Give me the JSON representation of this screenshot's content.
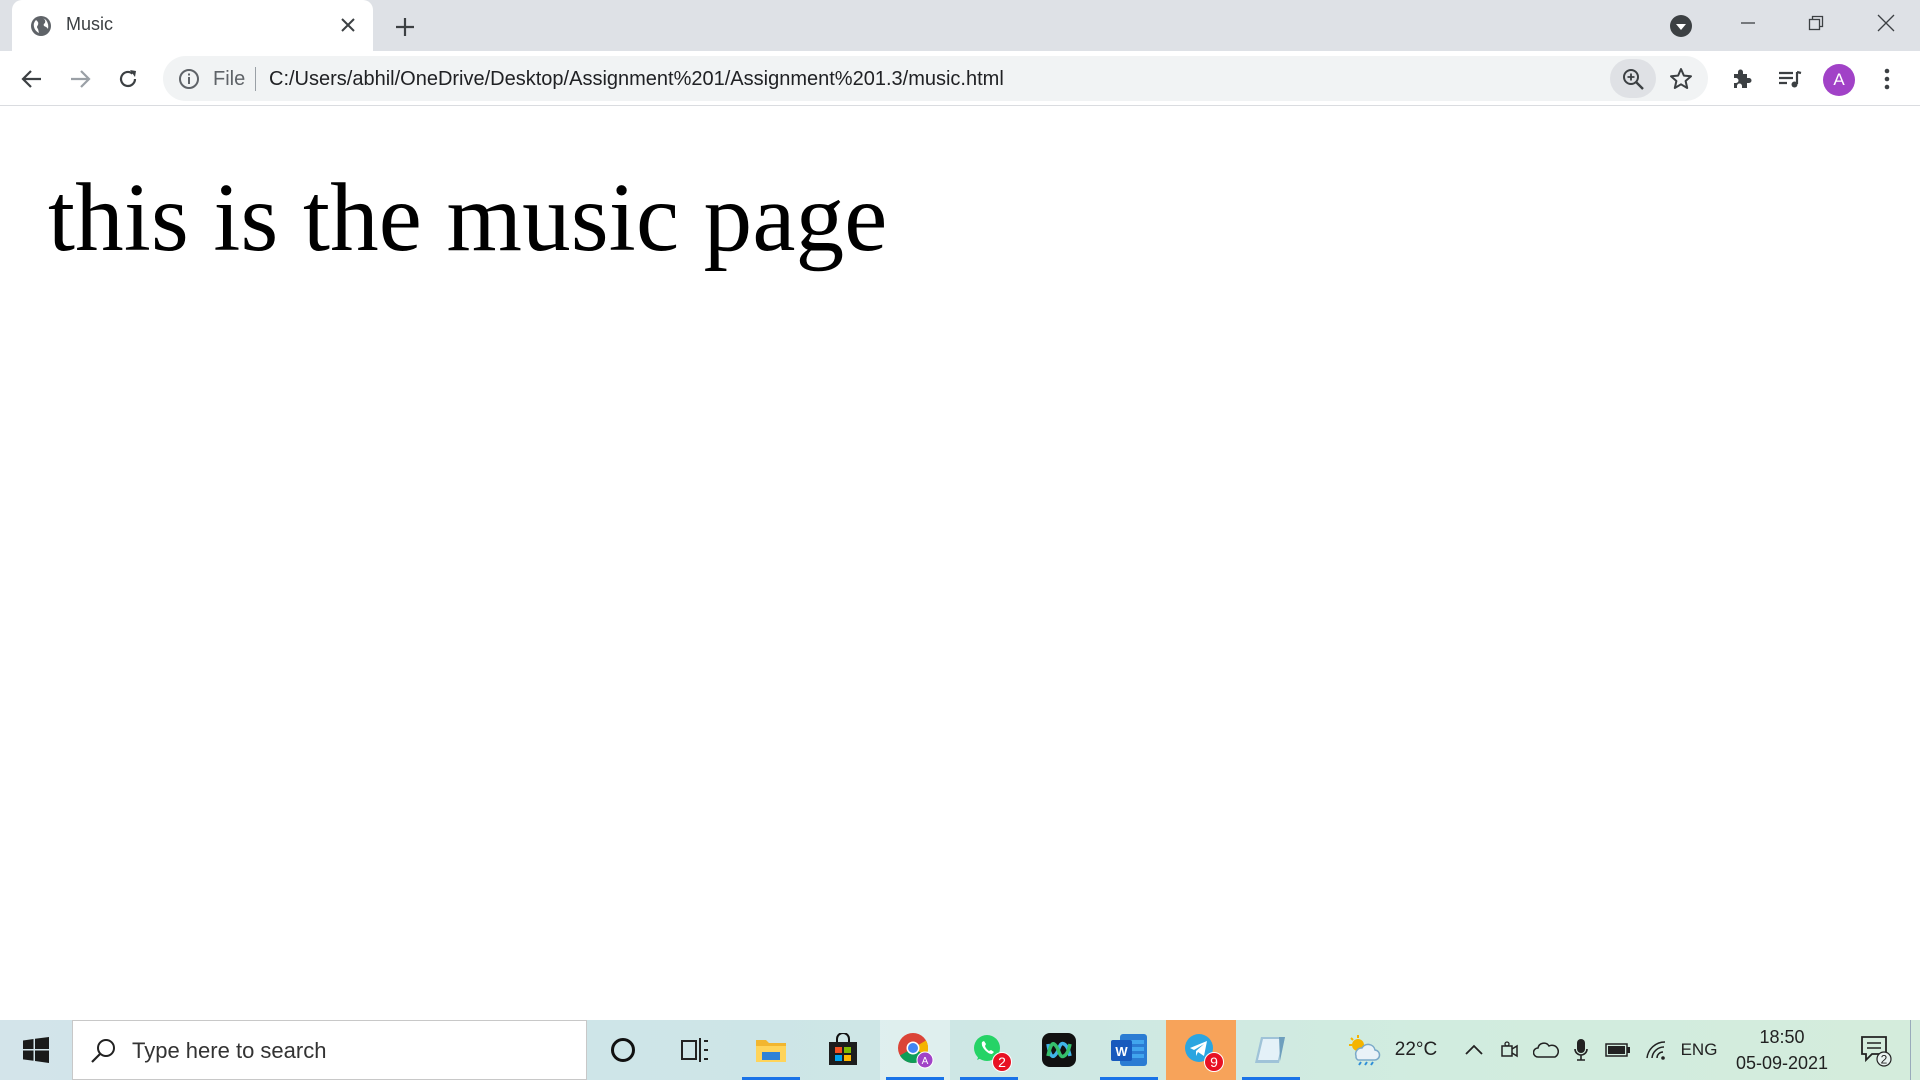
{
  "browser": {
    "tab_title": "Music",
    "omnibox_scheme_label": "File",
    "omnibox_url": "C:/Users/abhil/OneDrive/Desktop/Assignment%201/Assignment%201.3/music.html",
    "profile_initial": "A"
  },
  "page": {
    "heading": "this is the music page"
  },
  "taskbar": {
    "search_placeholder": "Type here to search",
    "apps": [
      {
        "name": "Cortana",
        "icon": "circle-icon"
      },
      {
        "name": "Task View",
        "icon": "task-view-icon"
      },
      {
        "name": "File Explorer",
        "icon": "folder-icon"
      },
      {
        "name": "Microsoft Store",
        "icon": "store-icon"
      },
      {
        "name": "Google Chrome",
        "icon": "chrome-icon"
      },
      {
        "name": "WhatsApp",
        "icon": "whatsapp-icon",
        "badge": "2"
      },
      {
        "name": "Webex",
        "icon": "webex-icon"
      },
      {
        "name": "Microsoft Word",
        "icon": "word-icon"
      },
      {
        "name": "Telegram",
        "icon": "telegram-icon",
        "badge": "9"
      },
      {
        "name": "Notepad",
        "icon": "notepad-icon"
      }
    ],
    "weather_temp": "22°C",
    "language": "ENG",
    "time": "18:50",
    "date": "05-09-2021",
    "notification_count": "2"
  },
  "colors": {
    "tabstrip_bg": "#dee1e6",
    "omnibox_bg": "#f1f3f4",
    "avatar": "#a142c7",
    "taskbar_active_underline": "#1a73e8"
  }
}
